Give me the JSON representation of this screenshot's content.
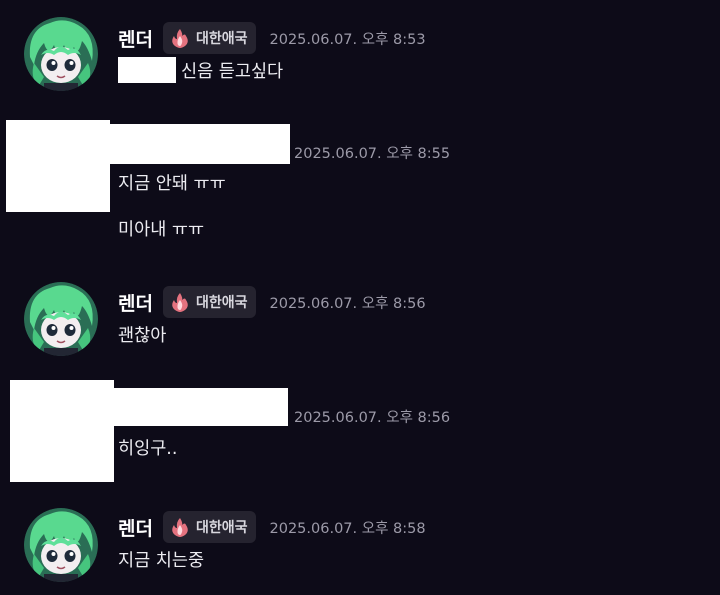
{
  "badge": {
    "label": "대한애국",
    "icon": "flame-icon",
    "color": "#e0707e"
  },
  "colors": {
    "background": "#0d0b18",
    "badge_bg": "#25232f",
    "timestamp": "#9c9aa8",
    "text": "#ececf1"
  },
  "messages": [
    {
      "author": "렌더",
      "timestamp": "2025.06.07. 오후 8:53",
      "lines": [
        "신음 듣고싶다"
      ]
    },
    {
      "author": "",
      "timestamp": "2025.06.07. 오후 8:55",
      "lines": [
        "지금 안돼 ㅠㅠ",
        "미아내 ㅠㅠ"
      ]
    },
    {
      "author": "렌더",
      "timestamp": "2025.06.07. 오후 8:56",
      "lines": [
        "괜찮아"
      ]
    },
    {
      "author": "",
      "timestamp": "2025.06.07. 오후 8:56",
      "lines": [
        "히잉구.."
      ]
    },
    {
      "author": "렌더",
      "timestamp": "2025.06.07. 오후 8:58",
      "lines": [
        "지금 치는중"
      ]
    }
  ]
}
